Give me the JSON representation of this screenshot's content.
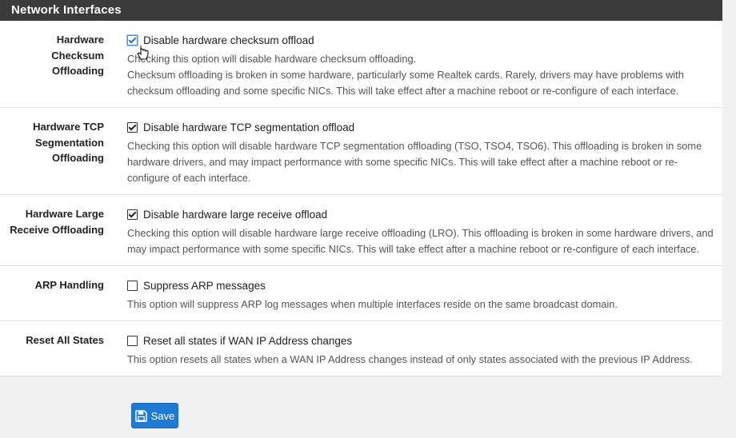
{
  "panel": {
    "title": "Network Interfaces"
  },
  "rows": [
    {
      "label_lines": [
        "Hardware",
        "Checksum",
        "Offloading"
      ],
      "checkbox_label": "Disable hardware checksum offload",
      "checked": true,
      "help": "Checking this option will disable hardware checksum offloading.",
      "help2": "Checksum offloading is broken in some hardware, particularly some Realtek cards. Rarely, drivers may have problems with checksum offloading and some specific NICs. This will take effect after a machine reboot or re-configure of each interface."
    },
    {
      "label_lines": [
        "Hardware TCP",
        "Segmentation",
        "Offloading"
      ],
      "checkbox_label": "Disable hardware TCP segmentation offload",
      "checked": true,
      "help": "Checking this option will disable hardware TCP segmentation offloading (TSO, TSO4, TSO6). This offloading is broken in some hardware drivers, and may impact performance with some specific NICs. This will take effect after a machine reboot or re-configure of each interface."
    },
    {
      "label_lines": [
        "Hardware Large",
        "Receive Offloading"
      ],
      "checkbox_label": "Disable hardware large receive offload",
      "checked": true,
      "help": "Checking this option will disable hardware large receive offloading (LRO). This offloading is broken in some hardware drivers, and may impact performance with some specific NICs. This will take effect after a machine reboot or re-configure of each interface."
    },
    {
      "label_lines": [
        "ARP Handling"
      ],
      "checkbox_label": "Suppress ARP messages",
      "checked": false,
      "help": "This option will suppress ARP log messages when multiple interfaces reside on the same broadcast domain."
    },
    {
      "label_lines": [
        "Reset All States"
      ],
      "checkbox_label": "Reset all states if WAN IP Address changes",
      "checked": false,
      "help": "This option resets all states when a WAN IP Address changes instead of only states associated with the previous IP Address."
    }
  ],
  "save_button": {
    "label": "Save",
    "icon": "save-icon",
    "color": "#1e7ad3"
  }
}
